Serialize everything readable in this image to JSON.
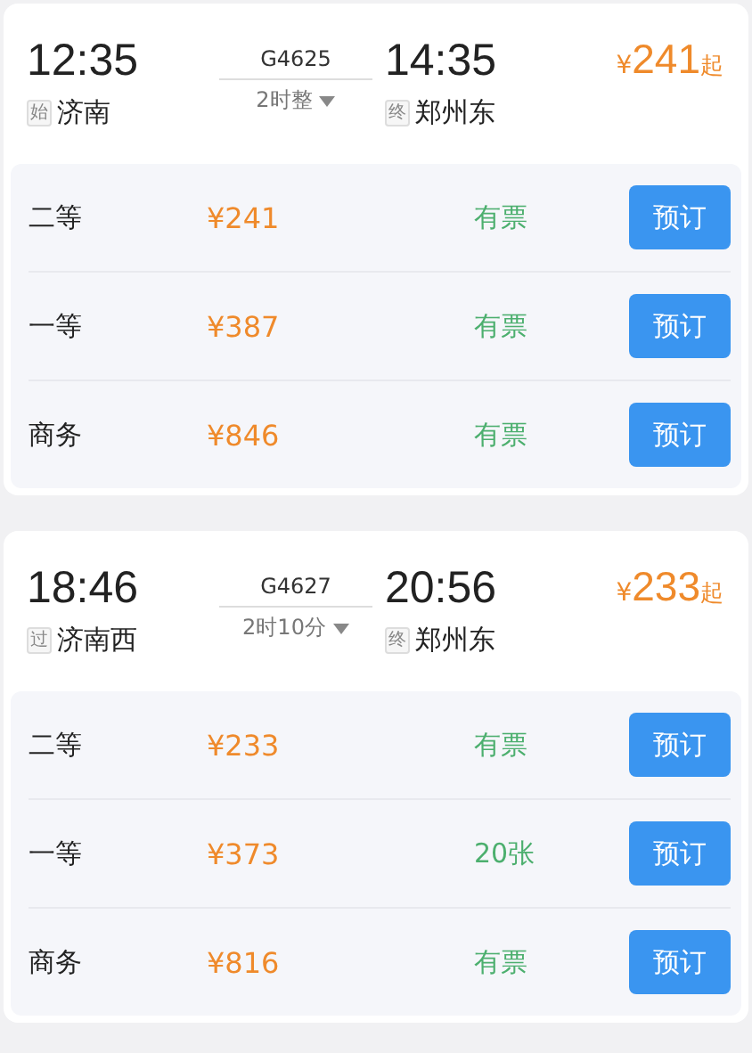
{
  "trains": [
    {
      "depart_time": "12:35",
      "depart_tag": "始",
      "depart_station": "济南",
      "train_no": "G4625",
      "duration": "2时整",
      "arrive_time": "14:35",
      "arrive_tag": "终",
      "arrive_station": "郑州东",
      "price_symbol": "¥",
      "price": "241",
      "price_suffix": "起",
      "expanded": true,
      "seats": [
        {
          "class": "二等",
          "price": "¥241",
          "availability": "有票",
          "button": "预订"
        },
        {
          "class": "一等",
          "price": "¥387",
          "availability": "有票",
          "button": "预订"
        },
        {
          "class": "商务",
          "price": "¥846",
          "availability": "有票",
          "button": "预订"
        }
      ]
    },
    {
      "depart_time": "18:46",
      "depart_tag": "过",
      "depart_station": "济南西",
      "train_no": "G4627",
      "duration": "2时10分",
      "arrive_time": "20:56",
      "arrive_tag": "终",
      "arrive_station": "郑州东",
      "price_symbol": "¥",
      "price": "233",
      "price_suffix": "起",
      "expanded": true,
      "seats": [
        {
          "class": "二等",
          "price": "¥233",
          "availability": "有票",
          "button": "预订"
        },
        {
          "class": "一等",
          "price": "¥373",
          "availability": "20张",
          "button": "预订"
        },
        {
          "class": "商务",
          "price": "¥816",
          "availability": "有票",
          "button": "预订"
        }
      ]
    }
  ]
}
